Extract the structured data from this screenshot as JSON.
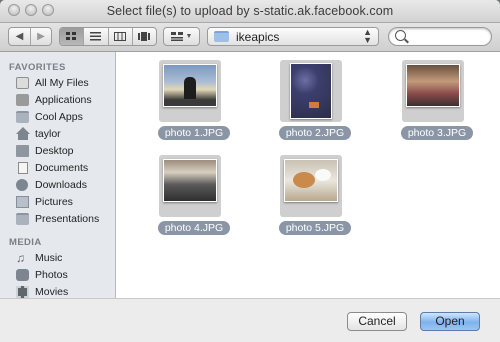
{
  "window": {
    "title": "Select file(s) to upload by s-static.ak.facebook.com"
  },
  "toolbar": {
    "back_icon": "chevron-left-icon",
    "forward_icon": "chevron-right-icon",
    "view_modes": [
      "icon-view",
      "list-view",
      "column-view",
      "coverflow-view"
    ],
    "active_view": "icon-view",
    "arrange_icon": "arrange-menu-icon",
    "location": "ikeapics",
    "search_placeholder": "",
    "search_value": ""
  },
  "sidebar": {
    "favorites_header": "FAVORITES",
    "favorites": [
      {
        "label": "All My Files",
        "icon": "all-files-icon"
      },
      {
        "label": "Applications",
        "icon": "applications-icon"
      },
      {
        "label": "Cool Apps",
        "icon": "folder-icon"
      },
      {
        "label": "taylor",
        "icon": "home-icon"
      },
      {
        "label": "Desktop",
        "icon": "desktop-icon"
      },
      {
        "label": "Documents",
        "icon": "documents-icon"
      },
      {
        "label": "Downloads",
        "icon": "downloads-icon"
      },
      {
        "label": "Pictures",
        "icon": "pictures-icon"
      },
      {
        "label": "Presentations",
        "icon": "folder-icon"
      }
    ],
    "media_header": "MEDIA",
    "media": [
      {
        "label": "Music",
        "icon": "music-icon"
      },
      {
        "label": "Photos",
        "icon": "photos-icon"
      },
      {
        "label": "Movies",
        "icon": "movies-icon"
      }
    ]
  },
  "files": [
    {
      "name": "photo 1.JPG"
    },
    {
      "name": "photo 2.JPG"
    },
    {
      "name": "photo 3.JPG"
    },
    {
      "name": "photo 4.JPG"
    },
    {
      "name": "photo 5.JPG"
    }
  ],
  "buttons": {
    "cancel": "Cancel",
    "open": "Open"
  },
  "colors": {
    "selection_pill": "#8a96a6",
    "primary_button": "#7fb2ec",
    "sidebar_bg": "#e5e9ee"
  }
}
